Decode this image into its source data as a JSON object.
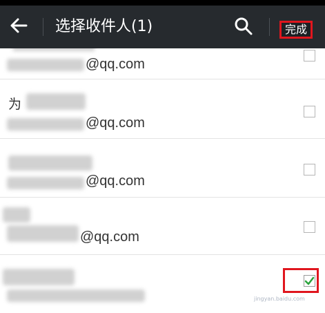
{
  "header": {
    "title": "选择收件人(1)",
    "done_label": "完成",
    "accent_color": "#e0161e",
    "bar_color": "#262a2e"
  },
  "contacts": [
    {
      "name": "",
      "email_suffix": "@qq.com",
      "checked": false
    },
    {
      "name": "为",
      "email_suffix": "@qq.com",
      "checked": false
    },
    {
      "name": "",
      "email_suffix": "@qq.com",
      "checked": false
    },
    {
      "name": "",
      "email_suffix": "@qq.com",
      "checked": false
    },
    {
      "name": "",
      "email_suffix": "",
      "checked": true
    }
  ],
  "watermark": "jingyan.baidu.com",
  "icons": [
    "back-arrow-icon",
    "search-icon",
    "checkmark-icon"
  ]
}
